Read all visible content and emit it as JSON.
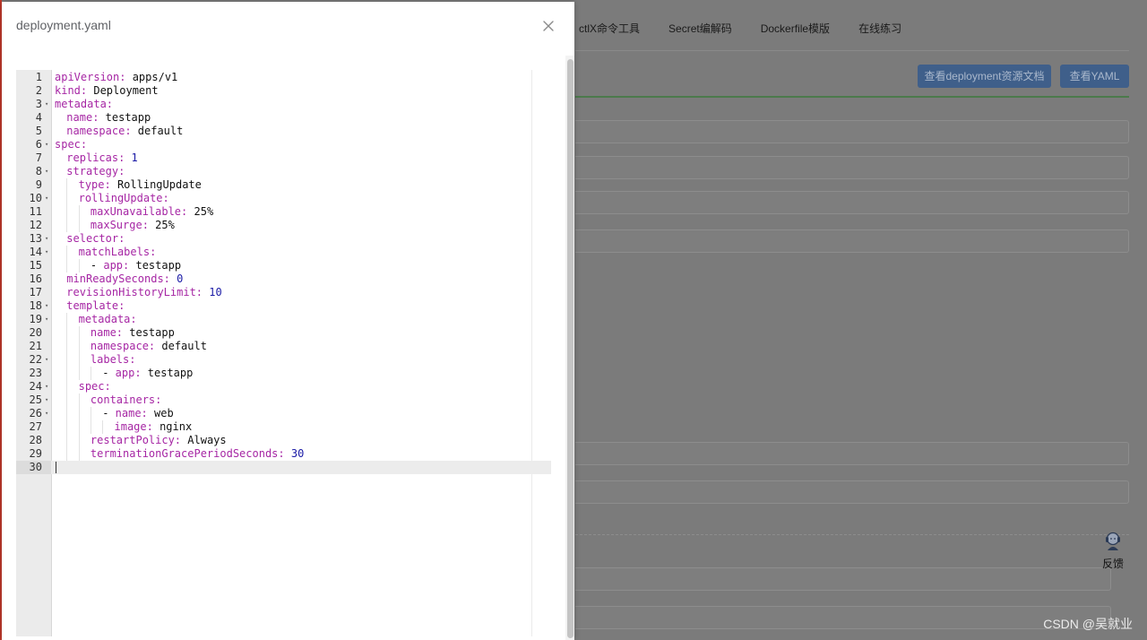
{
  "background_app": {
    "nav_items": [
      "ctlX命令工具",
      "Secret编解码",
      "Dockerfile模版",
      "在线练习"
    ],
    "buttons": {
      "deployment_docs": "查看deployment资源文档",
      "view_yaml": "查看YAML"
    },
    "feedback_label": "反馈",
    "feedback_icon": "customer-service-icon"
  },
  "modal": {
    "title": "deployment.yaml",
    "close_icon": "close-icon"
  },
  "editor": {
    "active_line": 30,
    "lines": [
      {
        "n": "1",
        "indent": 0,
        "key": "apiVersion:",
        "val": " apps/v1",
        "vtype": "str",
        "fold": false
      },
      {
        "n": "2",
        "indent": 0,
        "key": "kind:",
        "val": " Deployment",
        "vtype": "str",
        "fold": false
      },
      {
        "n": "3",
        "indent": 0,
        "key": "metadata:",
        "val": "",
        "vtype": "str",
        "fold": true
      },
      {
        "n": "4",
        "indent": 1,
        "key": "name:",
        "val": " testapp",
        "vtype": "str",
        "fold": false
      },
      {
        "n": "5",
        "indent": 1,
        "key": "namespace:",
        "val": " default",
        "vtype": "str",
        "fold": false
      },
      {
        "n": "6",
        "indent": 0,
        "key": "spec:",
        "val": "",
        "vtype": "str",
        "fold": true
      },
      {
        "n": "7",
        "indent": 1,
        "key": "replicas:",
        "val": " 1",
        "vtype": "num",
        "fold": false
      },
      {
        "n": "8",
        "indent": 1,
        "key": "strategy:",
        "val": "",
        "vtype": "str",
        "fold": true
      },
      {
        "n": "9",
        "indent": 2,
        "key": "type:",
        "val": " RollingUpdate",
        "vtype": "str",
        "fold": false
      },
      {
        "n": "10",
        "indent": 2,
        "key": "rollingUpdate:",
        "val": "",
        "vtype": "str",
        "fold": true
      },
      {
        "n": "11",
        "indent": 3,
        "key": "maxUnavailable:",
        "val": " 25%",
        "vtype": "str",
        "fold": false
      },
      {
        "n": "12",
        "indent": 3,
        "key": "maxSurge:",
        "val": " 25%",
        "vtype": "str",
        "fold": false
      },
      {
        "n": "13",
        "indent": 1,
        "key": "selector:",
        "val": "",
        "vtype": "str",
        "fold": true
      },
      {
        "n": "14",
        "indent": 2,
        "key": "matchLabels:",
        "val": "",
        "vtype": "str",
        "fold": true
      },
      {
        "n": "15",
        "indent": 3,
        "key": "- app:",
        "val": " testapp",
        "vtype": "str",
        "fold": false,
        "dash": true
      },
      {
        "n": "16",
        "indent": 1,
        "key": "minReadySeconds:",
        "val": " 0",
        "vtype": "num",
        "fold": false
      },
      {
        "n": "17",
        "indent": 1,
        "key": "revisionHistoryLimit:",
        "val": " 10",
        "vtype": "num",
        "fold": false
      },
      {
        "n": "18",
        "indent": 1,
        "key": "template:",
        "val": "",
        "vtype": "str",
        "fold": true
      },
      {
        "n": "19",
        "indent": 2,
        "key": "metadata:",
        "val": "",
        "vtype": "str",
        "fold": true
      },
      {
        "n": "20",
        "indent": 3,
        "key": "name:",
        "val": " testapp",
        "vtype": "str",
        "fold": false
      },
      {
        "n": "21",
        "indent": 3,
        "key": "namespace:",
        "val": " default",
        "vtype": "str",
        "fold": false
      },
      {
        "n": "22",
        "indent": 3,
        "key": "labels:",
        "val": "",
        "vtype": "str",
        "fold": true
      },
      {
        "n": "23",
        "indent": 4,
        "key": "- app:",
        "val": " testapp",
        "vtype": "str",
        "fold": false,
        "dash": true
      },
      {
        "n": "24",
        "indent": 2,
        "key": "spec:",
        "val": "",
        "vtype": "str",
        "fold": true
      },
      {
        "n": "25",
        "indent": 3,
        "key": "containers:",
        "val": "",
        "vtype": "str",
        "fold": true
      },
      {
        "n": "26",
        "indent": 4,
        "key": "- name:",
        "val": " web",
        "vtype": "str",
        "fold": true,
        "dash": true
      },
      {
        "n": "27",
        "indent": 5,
        "key": "image:",
        "val": " nginx",
        "vtype": "str",
        "fold": false
      },
      {
        "n": "28",
        "indent": 3,
        "key": "restartPolicy:",
        "val": " Always",
        "vtype": "str",
        "fold": false
      },
      {
        "n": "29",
        "indent": 3,
        "key": "terminationGracePeriodSeconds:",
        "val": " 30",
        "vtype": "num",
        "fold": false
      },
      {
        "n": "30",
        "indent": 0,
        "key": "",
        "val": "",
        "vtype": "str",
        "fold": false
      }
    ]
  },
  "watermark": "CSDN @吴就业"
}
